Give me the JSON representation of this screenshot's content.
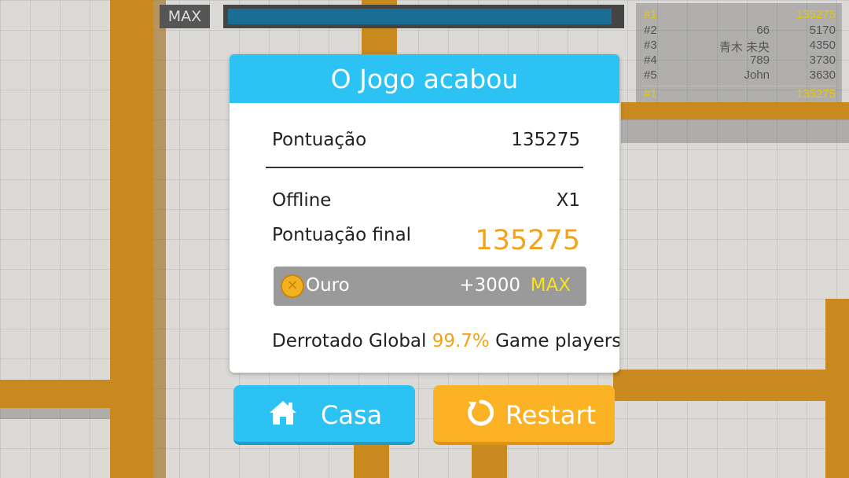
{
  "hud": {
    "max_label": "MAX",
    "progress_fraction": 0.98
  },
  "leaderboard": {
    "rows": [
      {
        "rank": "#1",
        "name": "",
        "score": "135275",
        "me": true
      },
      {
        "rank": "#2",
        "name": "66",
        "score": "5170",
        "me": false
      },
      {
        "rank": "#3",
        "name": "青木 未央",
        "score": "4350",
        "me": false
      },
      {
        "rank": "#4",
        "name": "789",
        "score": "3730",
        "me": false
      },
      {
        "rank": "#5",
        "name": "John",
        "score": "3630",
        "me": false
      }
    ],
    "self": {
      "rank": "#1",
      "score": "135275"
    }
  },
  "dialog": {
    "title": "O Jogo acabou",
    "score_label": "Pontuação",
    "score_value": "135275",
    "mode_label": "Offline",
    "multiplier": "X1",
    "final_label": "Pontuação final",
    "final_value": "135275",
    "gold": {
      "label": "Ouro",
      "amount": "+3000",
      "max": "MAX",
      "icon": "gold-coin-icon"
    },
    "defeat": {
      "prefix": "Derrotado Global",
      "percent": "99.7%",
      "suffix": "Game players"
    }
  },
  "buttons": {
    "home_label": "Casa",
    "home_icon": "house-icon",
    "restart_label": "Restart",
    "restart_icon": "restart-icon"
  },
  "colors": {
    "accent_blue": "#2cc3f4",
    "accent_orange": "#fbb225",
    "highlight_yellow": "#f2a21c"
  }
}
